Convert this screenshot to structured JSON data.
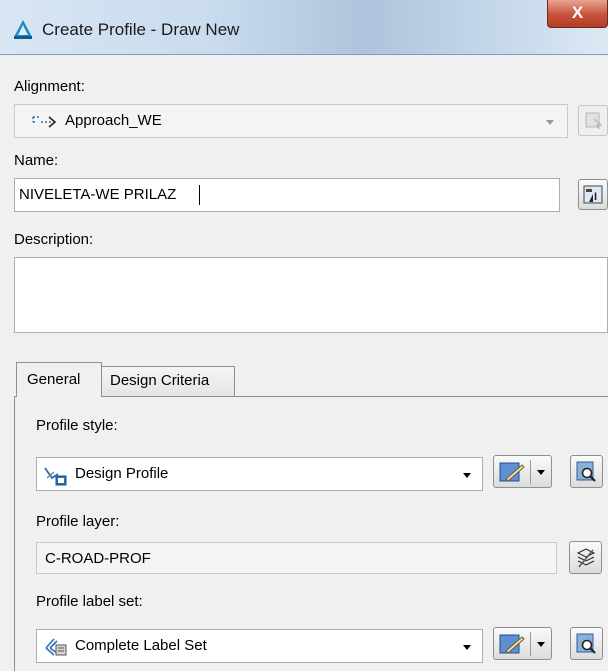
{
  "window": {
    "title": "Create Profile - Draw New",
    "close_label": "X"
  },
  "alignment": {
    "label": "Alignment:",
    "value": "Approach_WE",
    "icon": "alignment-icon"
  },
  "name": {
    "label": "Name:",
    "value": "NIVELETA-WE PRILAZ"
  },
  "description": {
    "label": "Description:",
    "value": ""
  },
  "tabs": [
    {
      "label": "General",
      "selected": true
    },
    {
      "label": "Design Criteria",
      "selected": false
    }
  ],
  "general": {
    "profile_style": {
      "label": "Profile style:",
      "value": "Design Profile",
      "icon": "profile-style-icon"
    },
    "profile_layer": {
      "label": "Profile layer:",
      "value": "C-ROAD-PROF"
    },
    "profile_label_set": {
      "label": "Profile label set:",
      "value": "Complete Label Set",
      "icon": "label-set-icon"
    }
  },
  "colors": {
    "close_button": "#c8523a",
    "titlebar": "#c9dbee",
    "accent_blue": "#2f6fb8"
  }
}
